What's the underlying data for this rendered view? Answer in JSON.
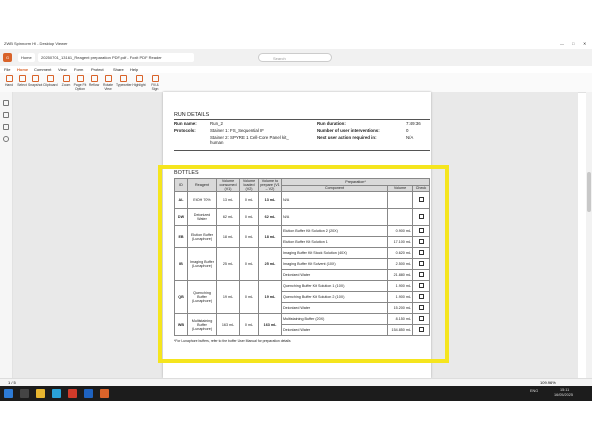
{
  "window": {
    "title": "ZWB Spinnorm Hl - Desktop Viewer",
    "controls": [
      "—",
      "□",
      "✕"
    ]
  },
  "tabs": {
    "home_label": "Home",
    "file_name": "20250701_13161_Reagent preparation PDF.pdf - Foxit PDF Reader",
    "search_placeholder": "Search"
  },
  "menu": [
    "File",
    "Home",
    "Comment",
    "View",
    "Form",
    "Protect",
    "Share",
    "Help"
  ],
  "ribbon": [
    "Hand",
    "Select",
    "Snapshot",
    "Clipboard",
    "Zoom",
    "Page Fit Option",
    "Reflow",
    "Rotate View",
    "Typewriter",
    "Highlight",
    "Fill & Sign"
  ],
  "run_details": {
    "heading": "RUN DETAILS",
    "run_name_label": "Run name:",
    "run_name": "Run_2",
    "protocols_label": "Protocols:",
    "protocol_1": "Stainer 1: FS_Sequential IF",
    "protocol_2a": "Stainer 2: SPYRE 1 Cell-Core Panel kit_",
    "protocol_2b": "human",
    "duration_label": "Run duration:",
    "duration": "7:49:36",
    "interventions_label": "Number of user interventions:",
    "interventions": "0",
    "next_action_label": "Next user action required in:",
    "next_action": "N/A"
  },
  "bottles": {
    "heading": "BOTTLES",
    "headers": {
      "id": "ID",
      "reagent": "Reagent",
      "consumed": "Volume consumed (V1)",
      "loaded": "Volume loaded (V2)",
      "prepare": "Volume to prepare (V1 – V2)",
      "preparation": "Preparation*",
      "component": "Component",
      "volume": "Volume",
      "check": "Check"
    },
    "rows": [
      {
        "id": "AL",
        "reagent": "EtOH 70%",
        "consumed": "13 mL",
        "loaded": "0 mL",
        "prepare": "13 mL",
        "components": [
          {
            "name": "N/A",
            "volume": ""
          }
        ]
      },
      {
        "id": "DW",
        "reagent": "Deionized Water",
        "consumed": "62 mL",
        "loaded": "0 mL",
        "prepare": "62 mL",
        "components": [
          {
            "name": "N/A",
            "volume": ""
          }
        ]
      },
      {
        "id": "EB",
        "reagent": "Elution Buffer (Lunaphore)",
        "consumed": "18 mL",
        "loaded": "0 mL",
        "prepare": "18 mL",
        "components": [
          {
            "name": "Elution Buffer Kit Solution 2 (20X)",
            "volume": "0.900 mL"
          },
          {
            "name": "Elution Buffer Kit Solution 1",
            "volume": "17.100 mL"
          }
        ]
      },
      {
        "id": "IB",
        "reagent": "Imaging Buffer (Lunaphore)",
        "consumed": "25 mL",
        "loaded": "0 mL",
        "prepare": "25 mL",
        "components": [
          {
            "name": "Imaging Buffer Kit Stock Solution (40X)",
            "volume": "0.620 mL"
          },
          {
            "name": "Imaging Buffer Kit Solvent (10X)",
            "volume": "2.500 mL"
          },
          {
            "name": "Deionized Water",
            "volume": "21.880 mL"
          }
        ]
      },
      {
        "id": "QB",
        "reagent": "Quenching Buffer (Lunaphore)",
        "consumed": "19 mL",
        "loaded": "0 mL",
        "prepare": "19 mL",
        "components": [
          {
            "name": "Quenching Buffer Kit Solution 1 (10X)",
            "volume": "1.900 mL"
          },
          {
            "name": "Quenching Buffer Kit Solution 2 (10X)",
            "volume": "1.900 mL"
          },
          {
            "name": "Deionized Water",
            "volume": "15.200 mL"
          }
        ]
      },
      {
        "id": "WB",
        "reagent": "Multistaining Buffer (Lunaphore)",
        "consumed": "163 mL",
        "loaded": "0 mL",
        "prepare": "163 mL",
        "components": [
          {
            "name": "Multistaining Buffer (20X)",
            "volume": "8.150 mL"
          },
          {
            "name": "Deionized Water",
            "volume": "154.850 mL"
          }
        ]
      }
    ],
    "footnote": "*For Lunaphore buffers, refer to the buffer User Manual for preparation details"
  },
  "status": {
    "page": "1 / 5",
    "zoom": "109.96%"
  },
  "taskbar": {
    "time": "15:11",
    "date": "16/05/2025",
    "lang": "ENG"
  },
  "colors": {
    "highlight": "#f5e51e",
    "accent": "#d9632a"
  }
}
